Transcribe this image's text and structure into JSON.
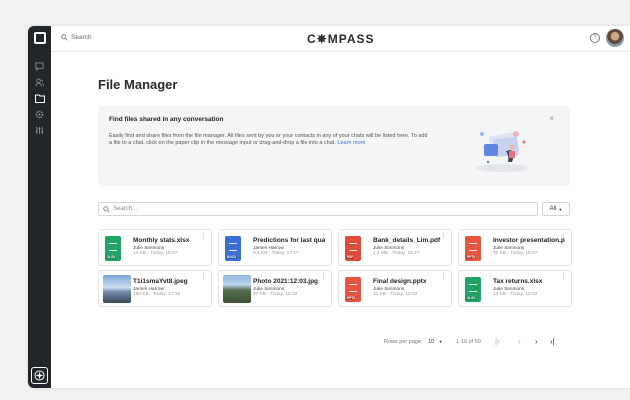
{
  "topbar": {
    "search_placeholder": "Search",
    "logo": "C✵MPASS",
    "help_icon": "?"
  },
  "page_title": "File Manager",
  "banner": {
    "title": "Find files shared in any conversation",
    "text": "Easily find and share files from the file manager.  All files sent by you or your contacts in any of your chats will be listed here. To add a file to a chat, click on the paper clip in the message input or drag-and-drop a file into a chat.",
    "link": "Learn more",
    "close": "×"
  },
  "filter": {
    "search_placeholder": "Search...",
    "select_value": "All"
  },
  "files": [
    {
      "name": "Monthly stats.xlsx",
      "owner": "Julie Simmons",
      "meta": "14 KB · Today, 15:27",
      "tag": "XLSX",
      "kind": "xlsx",
      "color": "#21a366"
    },
    {
      "name": "Predictions for last quart",
      "owner": "James Harrow",
      "meta": "9.1 KB · Today, 17:17",
      "tag": "DOCX",
      "kind": "docx",
      "color": "#3b6fd6"
    },
    {
      "name": "Bank_details_Lim.pdf",
      "owner": "Julie Simmons",
      "meta": "1.1 MB · Today, 15:27",
      "tag": "PDF",
      "kind": "pdf",
      "color": "#e04b3c"
    },
    {
      "name": "Investor presentation.pptx",
      "owner": "Julie Simmons",
      "meta": "31 KB · Today, 15:27",
      "tag": "PPTX",
      "kind": "pptx",
      "color": "#e8553e"
    },
    {
      "name": "T1i1smaYvt8.jpeg",
      "owner": "James Harrow",
      "meta": "150 KB · Today, 17:19",
      "tag": "",
      "kind": "image-sky",
      "color": ""
    },
    {
      "name": "Photo 2021:12:03.jpg",
      "owner": "Julie Simmons",
      "meta": "97 KB · Today, 15:32",
      "tag": "",
      "kind": "image-mountain",
      "color": ""
    },
    {
      "name": "Final design.pptx",
      "owner": "Julie Simmons",
      "meta": "31 KB · Today, 10:32",
      "tag": "PPTX",
      "kind": "pptx",
      "color": "#e8553e"
    },
    {
      "name": "Tax returns.xlsx",
      "owner": "Julie Simmons",
      "meta": "14 KB · Today, 10:32",
      "tag": "XLSX",
      "kind": "xlsx",
      "color": "#21a366"
    }
  ],
  "pagination": {
    "rows_label": "Rows per page:",
    "rows_value": "10",
    "range": "1-10 of 50"
  }
}
